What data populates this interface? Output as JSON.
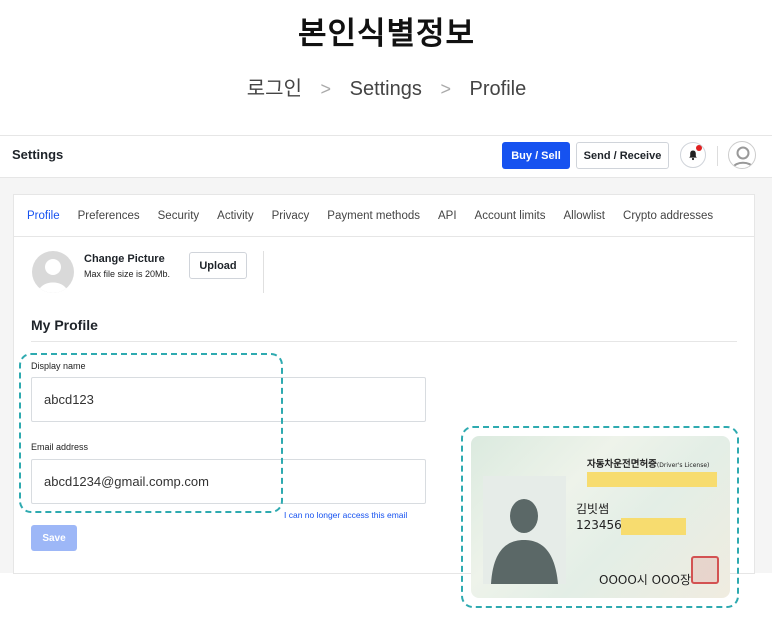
{
  "heading": "본인식별정보",
  "breadcrumb": {
    "items": [
      "로그인",
      "Settings",
      "Profile"
    ]
  },
  "topbar": {
    "title": "Settings",
    "buy_sell": "Buy / Sell",
    "send_receive": "Send / Receive"
  },
  "tabs": [
    "Profile",
    "Preferences",
    "Security",
    "Activity",
    "Privacy",
    "Payment methods",
    "API",
    "Account limits",
    "Allowlist",
    "Crypto addresses"
  ],
  "active_tab": "Profile",
  "picture": {
    "title": "Change Picture",
    "subtitle": "Max file size is 20Mb.",
    "upload_label": "Upload"
  },
  "profile": {
    "section_title": "My Profile",
    "display_name_label": "Display name",
    "display_name_value": "abcd123",
    "email_label": "Email address",
    "email_value": "abcd1234@gmail.comp.com",
    "help_link": "I can no longer access this email",
    "save_label": "Save"
  },
  "id_card": {
    "header": "자동차운전면허증",
    "header_en": "(Driver's License)",
    "name": "김빗썸",
    "number_prefix": "123456-",
    "issuer": "OOOO시 OOO장"
  },
  "colors": {
    "accent": "#1652f0",
    "highlight_dash": "#2eaab0",
    "notification": "#e02020"
  }
}
